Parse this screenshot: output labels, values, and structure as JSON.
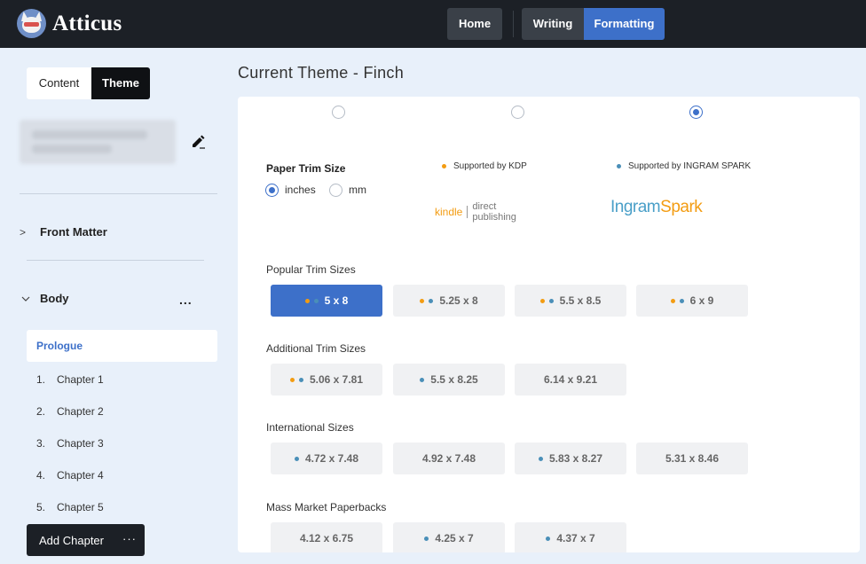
{
  "app": {
    "name": "Atticus"
  },
  "nav": {
    "home": "Home",
    "writing": "Writing",
    "formatting": "Formatting"
  },
  "sidebar": {
    "tabs": {
      "content": "Content",
      "theme": "Theme"
    },
    "front_matter": "Front Matter",
    "body": "Body",
    "body_more": "...",
    "prologue": "Prologue",
    "chapters": [
      {
        "num": "1.",
        "title": "Chapter 1"
      },
      {
        "num": "2.",
        "title": "Chapter 2"
      },
      {
        "num": "3.",
        "title": "Chapter 3"
      },
      {
        "num": "4.",
        "title": "Chapter 4"
      },
      {
        "num": "5.",
        "title": "Chapter 5"
      }
    ],
    "add_chapter": "Add Chapter",
    "add_chapter_more": "···"
  },
  "main": {
    "title": "Current Theme - Finch",
    "paper_trim_size": "Paper Trim Size",
    "units": {
      "inches": "inches",
      "mm": "mm",
      "selected": "inches"
    },
    "legend": {
      "kdp": "Supported by KDP",
      "ingram": "Supported by INGRAM SPARK"
    },
    "logos": {
      "kindle": "kindle",
      "direct": "direct",
      "publishing": "publishing",
      "ingram_a": "Ingram",
      "ingram_b": "Spark"
    },
    "groups": [
      {
        "label": "Popular Trim Sizes",
        "sizes": [
          {
            "label": "5 x 8",
            "kdp": true,
            "ingram": true,
            "active": true
          },
          {
            "label": "5.25 x 8",
            "kdp": true,
            "ingram": true
          },
          {
            "label": "5.5 x 8.5",
            "kdp": true,
            "ingram": true
          },
          {
            "label": "6 x 9",
            "kdp": true,
            "ingram": true
          }
        ]
      },
      {
        "label": "Additional Trim Sizes",
        "sizes": [
          {
            "label": "5.06 x 7.81",
            "kdp": true,
            "ingram": true
          },
          {
            "label": "5.5 x 8.25",
            "kdp": false,
            "ingram": true
          },
          {
            "label": "6.14 x 9.21",
            "kdp": false,
            "ingram": false
          }
        ]
      },
      {
        "label": "International Sizes",
        "sizes": [
          {
            "label": "4.72 x 7.48",
            "kdp": false,
            "ingram": true
          },
          {
            "label": "4.92 x 7.48",
            "kdp": false,
            "ingram": false
          },
          {
            "label": "5.83 x 8.27",
            "kdp": false,
            "ingram": true
          },
          {
            "label": "5.31 x 8.46",
            "kdp": false,
            "ingram": false
          }
        ]
      },
      {
        "label": "Mass Market Paperbacks",
        "sizes": [
          {
            "label": "4.12 x 6.75",
            "kdp": false,
            "ingram": false
          },
          {
            "label": "4.25 x 7",
            "kdp": false,
            "ingram": true
          },
          {
            "label": "4.37 x 7",
            "kdp": false,
            "ingram": true
          }
        ]
      }
    ]
  },
  "colors": {
    "accent": "#3d70c9",
    "topbar": "#1c2026",
    "kdp": "#f39c12",
    "ingram": "#4a8fb8"
  }
}
